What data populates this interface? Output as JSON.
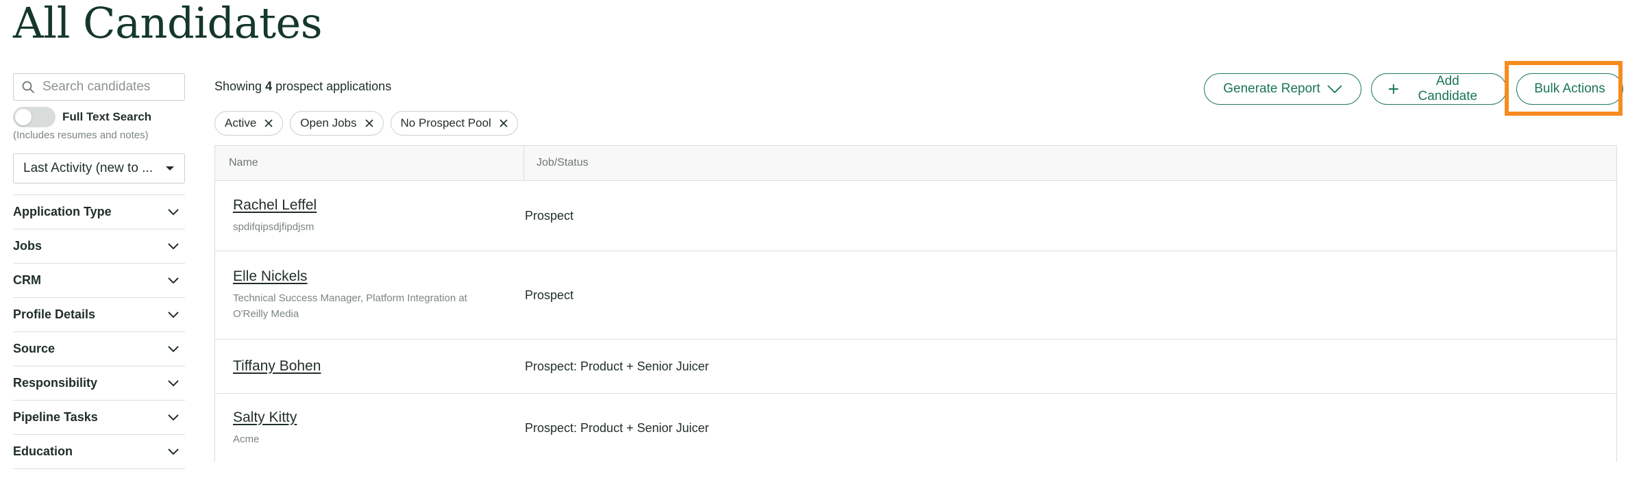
{
  "page": {
    "title": "All Candidates"
  },
  "sidebar": {
    "search_placeholder": "Search candidates",
    "full_text_search_label": "Full Text Search",
    "full_text_search_hint": "(Includes resumes and notes)",
    "sort_value": "Last Activity (new to ...",
    "filters": [
      "Application Type",
      "Jobs",
      "CRM",
      "Profile Details",
      "Source",
      "Responsibility",
      "Pipeline Tasks",
      "Education"
    ]
  },
  "main": {
    "showing_prefix": "Showing",
    "showing_count": "4",
    "showing_suffix": "prospect applications",
    "chips": [
      "Active",
      "Open Jobs",
      "No Prospect Pool"
    ],
    "actions": {
      "generate_report": "Generate Report",
      "add_candidate": "Add Candidate",
      "bulk_actions": "Bulk Actions"
    },
    "table": {
      "headers": {
        "name": "Name",
        "job_status": "Job/Status"
      },
      "rows": [
        {
          "name": "Rachel Leffel",
          "subtitle": "spdifqipsdjfipdjsm",
          "job_status": "Prospect"
        },
        {
          "name": "Elle Nickels",
          "subtitle": "Technical Success Manager, Platform Integration at O'Reilly Media",
          "job_status": "Prospect"
        },
        {
          "name": "Tiffany Bohen",
          "subtitle": "",
          "job_status": "Prospect: Product + Senior Juicer"
        },
        {
          "name": "Salty Kitty",
          "subtitle": "Acme",
          "job_status": "Prospect: Product + Senior Juicer"
        }
      ]
    }
  },
  "colors": {
    "brand_green": "#1a7554",
    "highlight_orange": "#f68b1f",
    "title_green": "#15372c"
  }
}
